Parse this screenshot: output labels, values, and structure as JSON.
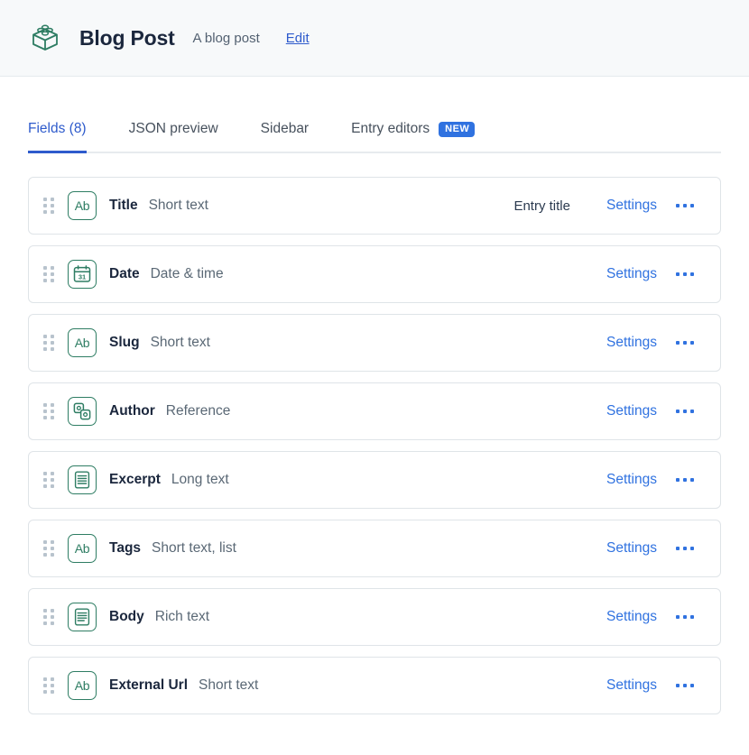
{
  "header": {
    "icon": "content-type-brick-icon",
    "title": "Blog Post",
    "description": "A blog post",
    "edit_label": "Edit"
  },
  "tabs": [
    {
      "label": "Fields (8)",
      "active": true,
      "badge": null
    },
    {
      "label": "JSON preview",
      "active": false,
      "badge": null
    },
    {
      "label": "Sidebar",
      "active": false,
      "badge": null
    },
    {
      "label": "Entry editors",
      "active": false,
      "badge": "NEW"
    }
  ],
  "row_actions": {
    "settings_label": "Settings",
    "more_label": "⋯",
    "drag_label": "drag-handle"
  },
  "fields": [
    {
      "name": "Title",
      "type": "Short text",
      "icon": "short-text-icon",
      "icon_text": "Ab",
      "tag": "Entry title"
    },
    {
      "name": "Date",
      "type": "Date & time",
      "icon": "calendar-icon",
      "icon_text": "31",
      "tag": ""
    },
    {
      "name": "Slug",
      "type": "Short text",
      "icon": "short-text-icon",
      "icon_text": "Ab",
      "tag": ""
    },
    {
      "name": "Author",
      "type": "Reference",
      "icon": "reference-icon",
      "icon_text": "",
      "tag": ""
    },
    {
      "name": "Excerpt",
      "type": "Long text",
      "icon": "long-text-icon",
      "icon_text": "",
      "tag": ""
    },
    {
      "name": "Tags",
      "type": "Short text, list",
      "icon": "short-text-icon",
      "icon_text": "Ab",
      "tag": ""
    },
    {
      "name": "Body",
      "type": "Rich text",
      "icon": "rich-text-icon",
      "icon_text": "",
      "tag": ""
    },
    {
      "name": "External Url",
      "type": "Short text",
      "icon": "short-text-icon",
      "icon_text": "Ab",
      "tag": ""
    }
  ],
  "colors": {
    "accent_blue": "#2e5bcc",
    "link_blue": "#3072e0",
    "icon_green": "#2e7d63",
    "text_dark": "#1b273d",
    "text_muted": "#5a6875",
    "header_bg": "#f7f9fa",
    "border": "#dfe4e8"
  }
}
